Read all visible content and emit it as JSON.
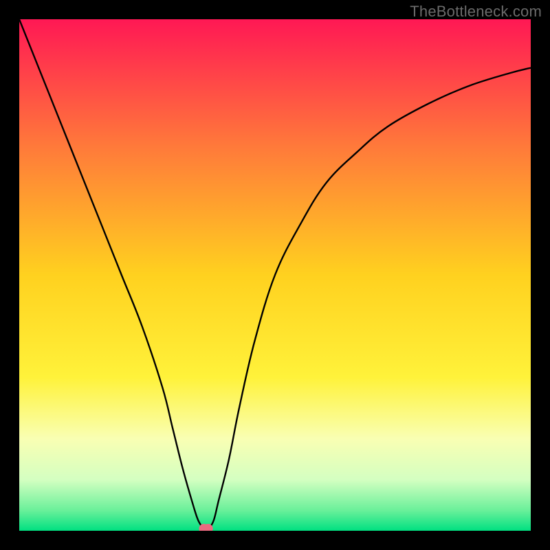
{
  "watermark": "TheBottleneck.com",
  "chart_data": {
    "type": "line",
    "title": "",
    "xlabel": "",
    "ylabel": "",
    "xlim": [
      0,
      100
    ],
    "ylim": [
      0,
      100
    ],
    "background_gradient": {
      "stops_top_to_bottom": [
        {
          "pct": 0.0,
          "color": "#ff1854"
        },
        {
          "pct": 0.25,
          "color": "#ff7a3a"
        },
        {
          "pct": 0.5,
          "color": "#ffd11f"
        },
        {
          "pct": 0.7,
          "color": "#fff23a"
        },
        {
          "pct": 0.82,
          "color": "#f9ffb3"
        },
        {
          "pct": 0.9,
          "color": "#d4ffc1"
        },
        {
          "pct": 0.96,
          "color": "#6af09a"
        },
        {
          "pct": 1.0,
          "color": "#00e081"
        }
      ]
    },
    "series": [
      {
        "name": "bottleneck-curve",
        "color": "#000000",
        "x": [
          0,
          4,
          8,
          12,
          16,
          20,
          24,
          28,
          30,
          32,
          34,
          35,
          36,
          37,
          38,
          39,
          41,
          43,
          46,
          50,
          55,
          60,
          66,
          72,
          80,
          88,
          96,
          100
        ],
        "values": [
          100,
          90,
          80,
          70,
          60,
          50,
          40,
          28,
          20,
          12,
          5,
          2,
          0.6,
          0.6,
          2,
          6,
          14,
          24,
          37,
          50,
          60,
          68,
          74,
          79,
          83.5,
          87,
          89.5,
          90.5
        ]
      }
    ],
    "marker": {
      "name": "current-point",
      "x": 36.5,
      "y": 0.4,
      "color": "#ec6a80",
      "radius": 7
    }
  }
}
